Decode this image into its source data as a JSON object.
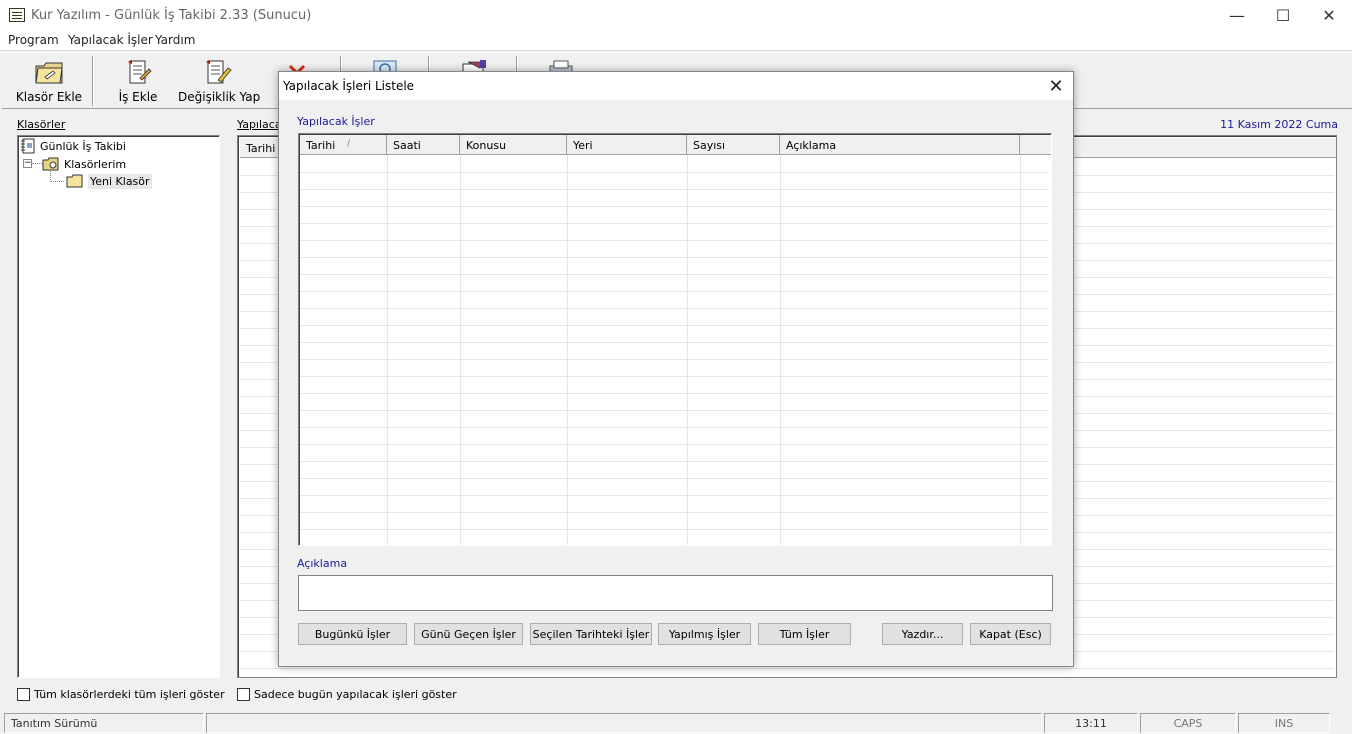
{
  "window": {
    "title": "Kur Yazılım - Günlük İş Takibi 2.33 (Sunucu)",
    "controls": {
      "minimize": "—",
      "maximize": "☐",
      "close": "✕"
    }
  },
  "menu": [
    "Program",
    "Yapılacak İşler",
    "Yardım"
  ],
  "toolbar": {
    "add_folder": "Klasör Ekle",
    "add_task": "İş Ekle",
    "edit": "Değişiklik Yap"
  },
  "left_panel": {
    "label": "Klasörler",
    "tree": {
      "root": "Günlük İş Takibi",
      "folders": "Klasörlerim",
      "new_folder": "Yeni Klasör",
      "expander": "−"
    }
  },
  "right_panel": {
    "label": "Yapılaca",
    "date": "11 Kasım 2022 Cuma",
    "columns": [
      "Tarihi"
    ]
  },
  "bottom": {
    "show_all": "Tüm klasörlerdeki tüm işleri göster",
    "today_only": "Sadece bugün yapılacak işleri göster"
  },
  "statusbar": {
    "edition": "Tanıtım Sürümü",
    "time": "13:11",
    "caps": "CAPS",
    "ins": "INS"
  },
  "dialog": {
    "title": "Yapılacak İşleri Listele",
    "close": "✕",
    "list_label": "Yapılacak İşler",
    "columns": [
      "Tarihi",
      "Saati",
      "Konusu",
      "Yeri",
      "Sayısı",
      "Açıklama"
    ],
    "sort_indicator": "/",
    "description_label": "Açıklama",
    "buttons": {
      "today": "Bugünkü İşler",
      "overdue": "Günü Geçen İşler",
      "selected_date": "Seçilen Tarihteki İşler",
      "done": "Yapılmış İşler",
      "all": "Tüm İşler",
      "print": "Yazdır...",
      "close": "Kapat (Esc)"
    }
  }
}
